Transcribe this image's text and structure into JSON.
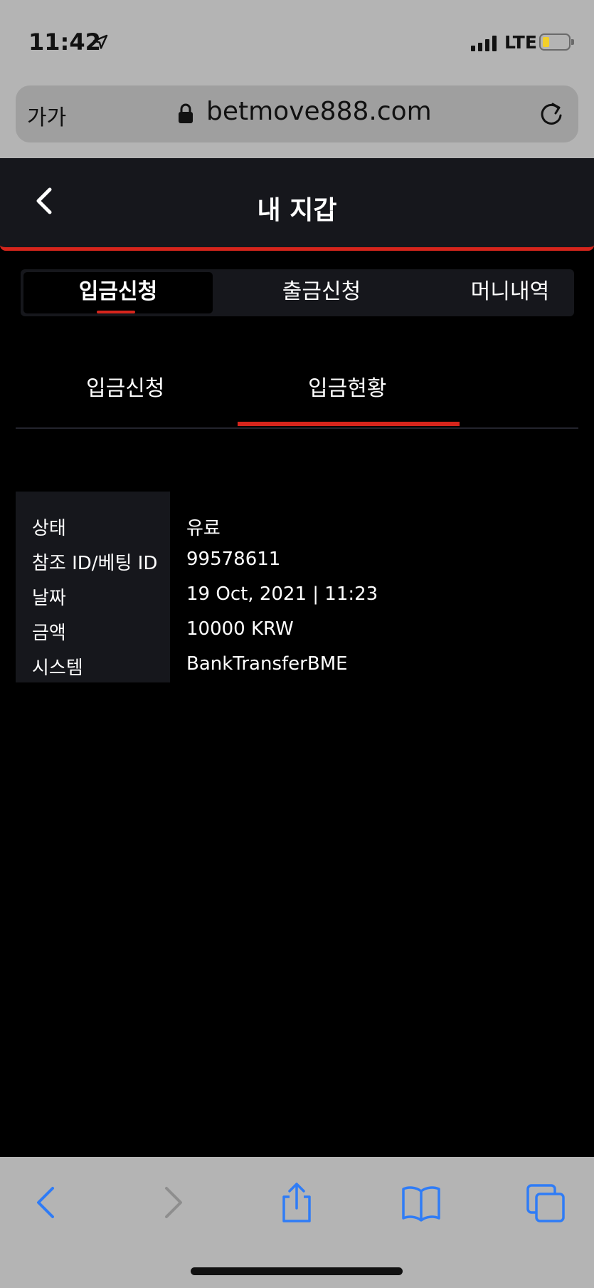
{
  "status_bar": {
    "time": "11:42",
    "network": "LTE"
  },
  "url_bar": {
    "text_size_label": "가가",
    "url": "betmove888.com"
  },
  "header": {
    "title": "내 지갑"
  },
  "top_tabs": [
    {
      "label": "입금신청",
      "active": true
    },
    {
      "label": "출금신청",
      "active": false
    },
    {
      "label": "머니내역",
      "active": false
    }
  ],
  "sub_tabs": [
    {
      "label": "입금신청",
      "active": false
    },
    {
      "label": "입금현황",
      "active": true
    }
  ],
  "details": [
    {
      "label": "상태",
      "value": "유료"
    },
    {
      "label": "참조 ID/베팅 ID",
      "value": "99578611"
    },
    {
      "label": "날짜",
      "value": "19 Oct, 2021 | 11:23"
    },
    {
      "label": "금액",
      "value": "10000 KRW"
    },
    {
      "label": "시스템",
      "value": "BankTransferBME"
    }
  ],
  "colors": {
    "accent": "#d6251c",
    "header_bg": "#16171c",
    "safari_chrome": "#b4b4b4",
    "toolbar_icon": "#2f7cf6"
  },
  "toolbar": {
    "icons": [
      "back-icon",
      "forward-icon",
      "share-icon",
      "bookmarks-icon",
      "tabs-icon"
    ]
  }
}
